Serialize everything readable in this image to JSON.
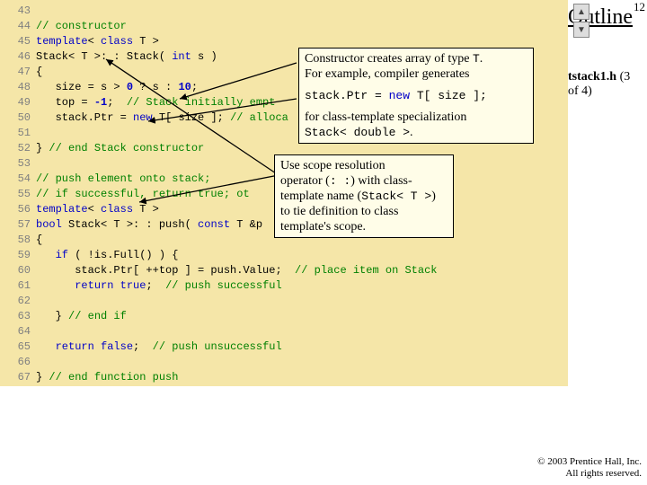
{
  "outline": {
    "title": "Outline",
    "page_number": "12",
    "file_label": "tstack1.h",
    "file_part": "(3 of 4)"
  },
  "footer": {
    "copyright": "© 2003 Prentice Hall, Inc.",
    "rights": "All rights reserved."
  },
  "line_numbers": [
    "43",
    "44",
    "45",
    "46",
    "47",
    "48",
    "49",
    "50",
    "51",
    "52",
    "53",
    "54",
    "55",
    "56",
    "57",
    "58",
    "59",
    "60",
    "61",
    "62",
    "63",
    "64",
    "65",
    "66",
    "67"
  ],
  "callouts": {
    "c1": {
      "text_l1": "Constructor creates array of type ",
      "text_l1_code": "T",
      "text_l1_end": ".",
      "text_l2": "For example, compiler generates",
      "code_line_pre": "stack.Ptr = ",
      "code_line_kw": "new",
      "code_line_post": " T[ size ];",
      "text_l4a": "for class-template specialization",
      "text_l4b_code": "Stack< double >",
      "text_l4b_end": "."
    },
    "c2": {
      "l1": "Use          scope resolution",
      "l2a": "operator (",
      "l2_code": ": :",
      "l2b": ") with class-",
      "l3a": "template name (",
      "l3_code": "Stack< T >",
      "l3b": ")",
      "l4": "to tie definition to class",
      "l5": "template's scope."
    }
  },
  "code": {
    "l43_c": "// constructor",
    "l44_k1": "template",
    "l44_n1": "< ",
    "l44_k2": "class",
    "l44_n2": " T >",
    "l45_n1": "Stack< T >: : Stack( ",
    "l45_k1": "int",
    "l45_n2": " s )",
    "l46": "{",
    "l47_pre": "   size = s > ",
    "l47_num0": "0",
    "l47_mid": " ? s : ",
    "l47_num10": "10",
    "l47_end": ";",
    "l48_pre": "   top = ",
    "l48_num": "-1",
    "l48_end": ";  ",
    "l48_c": "// Stack initially empt",
    "l49_pre": "   stack.Ptr = ",
    "l49_k": "new",
    "l49_post": " T[ size ]; ",
    "l49_c": "// alloca",
    "l51": "} ",
    "l51_c": "// end Stack constructor",
    "l53_c": "// push element onto stack;",
    "l54_c": "// if successful, return true; ot",
    "l55_k1": "template",
    "l55_n1": "< ",
    "l55_k2": "class",
    "l55_n2": " T >",
    "l55_tail": "T >",
    "l56_k1": "bool",
    "l56_n1": " Stack< T >: : push( ",
    "l56_k2": "const",
    "l56_n2": " T &p",
    "l57": "{",
    "l58_pre": "   ",
    "l58_k": "if",
    "l58_n": " ( !is.Full() ) {",
    "l59": "      stack.Ptr[ ++top ] = push.Value;  ",
    "l59_c": "// place item on Stack",
    "l60_pre": "      ",
    "l60_k": "return",
    "l60_n": " ",
    "l60_k2": "true",
    "l60_end": ";  ",
    "l60_c": "// push successful",
    "l62": "   } ",
    "l62_c": "// end if",
    "l64_pre": "   ",
    "l64_k": "return",
    "l64_n": " ",
    "l64_k2": "false",
    "l64_end": ";  ",
    "l64_c": "// push unsuccessful",
    "l66": "} ",
    "l66_c": "// end function push"
  }
}
